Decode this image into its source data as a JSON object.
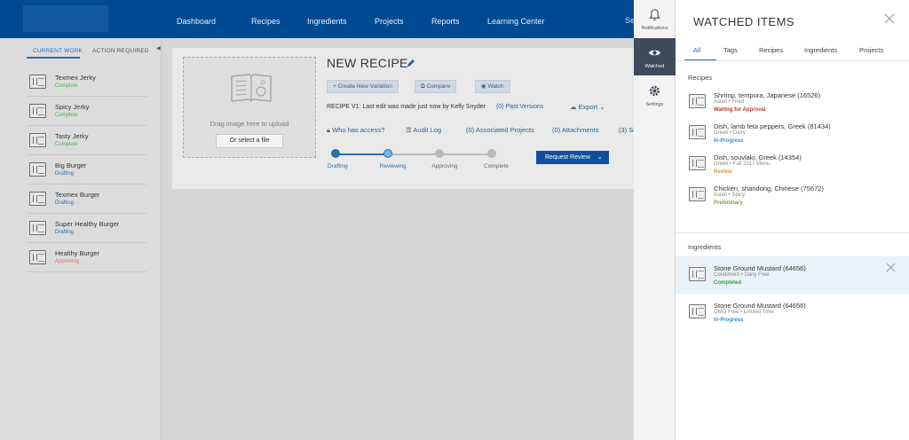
{
  "colors": {
    "nav_bg": "#004a91",
    "accent": "#2d6db2",
    "complete": "#4caf50",
    "drafting": "#2d6db2",
    "approving": "#e06666",
    "waiting": "#c0392b",
    "in_progress": "#2d8ed1",
    "review": "#e69138",
    "preliminary": "#6aa84f",
    "completed": "#38a33c"
  },
  "nav": {
    "items": [
      "Dashboard",
      "Recipes",
      "Ingredients",
      "Projects",
      "Reports",
      "Learning Center"
    ],
    "search_peek": "Se"
  },
  "sidebar": {
    "tabs": [
      "CURRENT WORK",
      "ACTION REQUIRED"
    ],
    "items": [
      {
        "name": "Texmex Jerky",
        "status": "Complete",
        "status_color": "#4caf50"
      },
      {
        "name": "Spicy Jerky",
        "status": "Complete",
        "status_color": "#4caf50"
      },
      {
        "name": "Tasty Jerky",
        "status": "Complete",
        "status_color": "#4caf50"
      },
      {
        "name": "Big Burger",
        "status": "Drafting",
        "status_color": "#2d6db2"
      },
      {
        "name": "Texmex Burger",
        "status": "Drafting",
        "status_color": "#2d6db2"
      },
      {
        "name": "Super Healthy Burger",
        "status": "Drafting",
        "status_color": "#2d6db2"
      },
      {
        "name": "Healthy Burger",
        "status": "Approving",
        "status_color": "#e06666"
      }
    ]
  },
  "upload": {
    "drag_text": "Drag image here to upload",
    "file_button": "Or select a file"
  },
  "recipe": {
    "title": "NEW RECIPE",
    "buttons": {
      "create_variation": "+ Create New Variation",
      "compare": "Compare",
      "watch": "Watch"
    },
    "meta_text": "RECIPE  V1: Last edit was made just now by Kelly Snyder",
    "past_versions": "(0) Past Versions",
    "export": "Export",
    "actions": {
      "who_has_access": "Who has access?",
      "audit_log": "Audit Log",
      "associated_projects": "(0) Associated Projects",
      "attachments": "(0) Attachments",
      "peek": "(3) Si"
    },
    "steps": [
      "Drafting",
      "Reviewing",
      "Approving",
      "Complete"
    ],
    "current_step_index": 1,
    "request_review": "Request Review"
  },
  "rail": {
    "notifications": "Notifications",
    "watched": "Watched",
    "settings": "Settings"
  },
  "panel": {
    "title": "WATCHED ITEMS",
    "tabs": [
      "All",
      "Tags",
      "Recipes",
      "Ingredients",
      "Projects"
    ],
    "recipes_heading": "Recipes",
    "recipes": [
      {
        "name": "Shrimp, tempura, Japanese (16526)",
        "tags": "Asian • Fried",
        "status": "Waiting for Approval",
        "status_color": "#c0392b"
      },
      {
        "name": "Dish, lamb feta peppers, Greek (81434)",
        "tags": "Greek • Dairy",
        "status": "In-Progress",
        "status_color": "#2d8ed1"
      },
      {
        "name": "Dish, souvlaki, Greek (14354)",
        "tags": "Greek • Fall 2017 Menu",
        "status": "Review",
        "status_color": "#e69138"
      },
      {
        "name": "Chicken, shandong, Chinese (75672)",
        "tags": "Asian • Spicy",
        "status": "Preliminary",
        "status_color": "#6aa84f"
      }
    ],
    "ingredients_heading": "Ingredients",
    "ingredients": [
      {
        "name": "Stone Ground Mustard (64656)",
        "tags": "Condiment • Dairy Free",
        "status": "Completed",
        "status_color": "#38a33c"
      },
      {
        "name": "Stone Ground Mustard (64656)",
        "tags": "GMO Free • Limited Time",
        "status": "In-Progress",
        "status_color": "#2d8ed1"
      }
    ]
  }
}
